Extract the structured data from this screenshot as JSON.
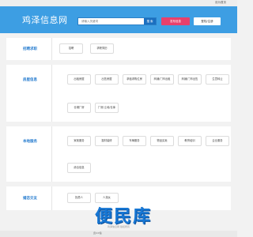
{
  "topbar": {
    "set_home": "设为首页"
  },
  "header": {
    "logo": "鸡泽信息网",
    "search_placeholder": "请输入关键词",
    "search_btn": "搜 索",
    "post_btn": "发布信息",
    "login_btn": "登陆/注册"
  },
  "sections": [
    {
      "title": "招聘求职",
      "tags": [
        "招聘",
        "求职简历"
      ]
    },
    {
      "title": "房屋信息",
      "tags": [
        "出租房屋",
        "出售房屋",
        "求租求购位房",
        "商铺/门市出租",
        "商铺/门市出售",
        "生意转让",
        "仓储厂房",
        "厂房/土地/仓库"
      ]
    },
    {
      "title": "本地服务",
      "tags": [
        "家政服务",
        "摄材装修",
        "车辆服务",
        "物品买卖",
        "教育培训",
        "企业服务",
        "综合信息"
      ]
    },
    {
      "title": "婚恋交友",
      "tags": [
        "找男人",
        "人找女"
      ]
    }
  ],
  "footer": {
    "copyright": "鸡泽信息网 版权所有",
    "tiny": "冀ICP备"
  },
  "watermark": "便民库"
}
